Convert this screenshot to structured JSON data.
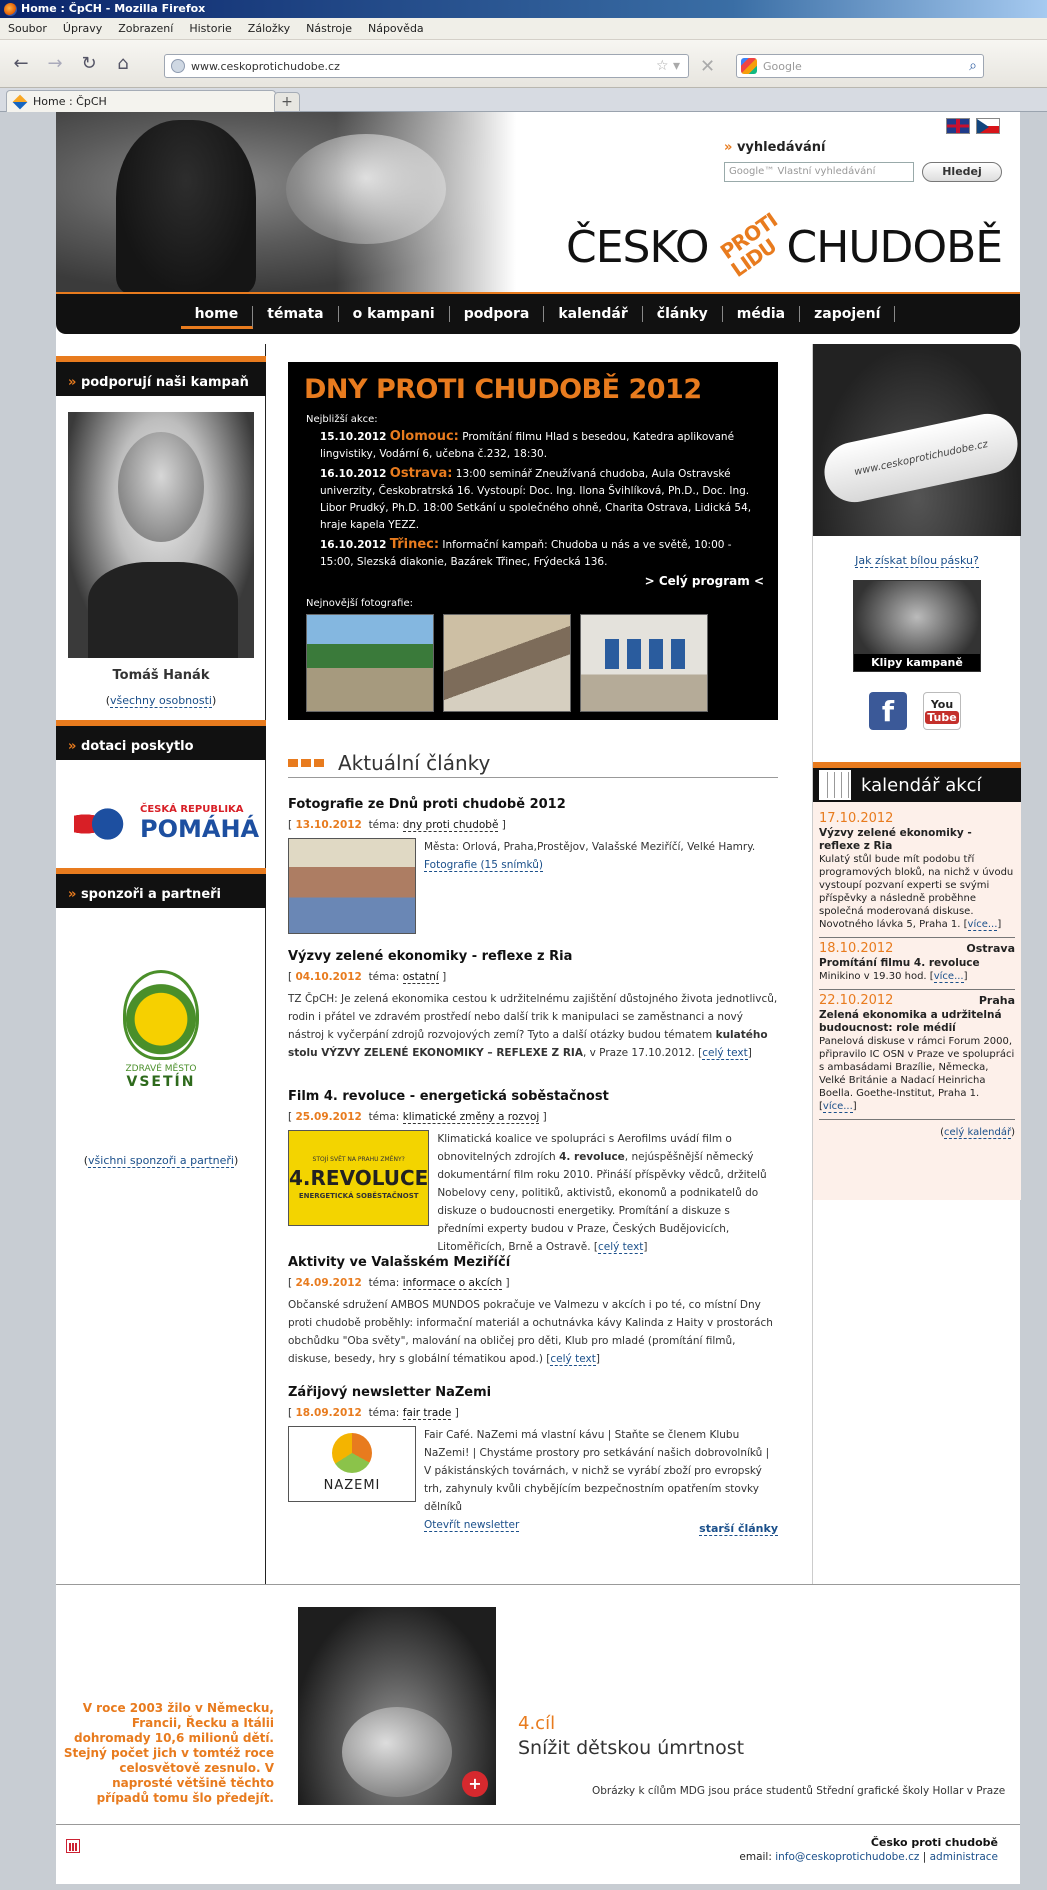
{
  "browser": {
    "title": "Home : ČpCH - Mozilla Firefox",
    "menu": [
      "Soubor",
      "Úpravy",
      "Zobrazení",
      "Historie",
      "Záložky",
      "Nástroje",
      "Nápověda"
    ],
    "url": "www.ceskoprotichudobe.cz",
    "search_placeholder": "Google",
    "tab_title": "Home : ČpCH",
    "new_tab": "+"
  },
  "header": {
    "search_label": "vyhledávání",
    "search_placeholder": "Google™ Vlastní vyhledávání",
    "search_button": "Hledej",
    "logo_left": "ČESKO",
    "logo_mid_top": "PROTI",
    "logo_mid_bottom": "LIDU",
    "logo_right": "CHUDOBĚ",
    "arrow": "»"
  },
  "nav": [
    "home",
    "témata",
    "o kampani",
    "podpora",
    "kalendář",
    "články",
    "média",
    "zapojení"
  ],
  "left": {
    "support_title": "podporují naši kampaň",
    "person_name": "Tomáš Hanák",
    "all_people_pre": "(",
    "all_people": "všechny osobnosti",
    "all_people_post": ")",
    "grant_title": "dotaci poskytlo",
    "cr_line1": "ČESKÁ REPUBLIKA",
    "cr_line2": "POMÁHÁ",
    "sponsors_title": "sponzoři a partneři",
    "vsetin_line1": "ZDRAVÉ MĚSTO",
    "vsetin_line2": "VSETÍN",
    "all_sponsors": "všichni sponzoři a partneři"
  },
  "banner": {
    "title": "DNY PROTI CHUDOBĚ 2012",
    "next_label": "Nejbližší akce:",
    "events": [
      {
        "date": "15.10.2012",
        "city": "Olomouc:",
        "text": "Promítání filmu Hlad s besedou, Katedra aplikované lingvistiky, Vodární 6, učebna č.232, 18:30."
      },
      {
        "date": "16.10.2012",
        "city": "Ostrava:",
        "text": "13:00 seminář Zneužívaná chudoba, Aula Ostravské univerzity, Českobratrská 16. Vystoupí: Doc. Ing. Ilona Švihlíková, Ph.D., Doc. Ing. Libor Prudký, Ph.D. 18:00 Setkání u společného ohně, Charita Ostrava, Lidická 54, hraje kapela YEZZ."
      },
      {
        "date": "16.10.2012",
        "city": "Třinec:",
        "text": "Informační kampaň: Chudoba u nás a ve světě, 10:00 - 15:00, Slezská diakonie, Bazárek Třinec, Frýdecká 136."
      }
    ],
    "full_program": "> Celý program <",
    "photos_label": "Nejnovější fotografie:"
  },
  "articles_title": "Aktuální články",
  "articles": [
    {
      "title": "Fotografie ze Dnů proti chudobě 2012",
      "date": "13.10.2012",
      "topic": "dny proti chudobě",
      "text": "Města: Orlová, Praha,Prostějov, Valašské Meziříčí, Velké Hamry.",
      "link": "Fotografie (15 snímků)"
    },
    {
      "title": "Výzvy zelené ekonomiky - reflexe z Ria",
      "date": "04.10.2012",
      "topic": "ostatní",
      "text": "TZ ČpCH: Je zelená ekonomika cestou k udržitelnému zajištění důstojného života jednotlivců, rodin i přátel ve zdravém prostředí nebo další trik k manipulaci se zaměstnanci a nový nástroj k vyčerpání zdrojů rozvojových zemí? Tyto a další otázky budou tématem",
      "bold": "kulatého stolu VÝZVY ZELENÉ EKONOMIKY – REFLEXE Z RIA",
      "text2": ", v Praze 17.10.2012.",
      "link": "celý text"
    },
    {
      "title": "Film 4. revoluce - energetická soběstačnost",
      "date": "25.09.2012",
      "topic": "klimatické změny a rozvoj",
      "text_a": "Klimatická koalice ve spolupráci s Aerofilms uvádí film o obnovitelných zdrojích",
      "bold": "4. revoluce",
      "text_b": ", nejúspěšnější německý dokumentární film roku 2010. Přináší příspěvky vědců, držitelů Nobelovy ceny, politiků, aktivistů, ekonomů a podnikatelů do diskuze o budoucnosti energetiky. Promítání a diskuze s předními experty budou v Praze, Českých Budějovicích, Litoměřicích, Brně a Ostravě.",
      "link": "celý text",
      "img_l1": "STOJÍ SVĚT NA PRAHU ZMĚNY?",
      "img_l2": "4.REVOLUCE",
      "img_l3": "ENERGETICKÁ SOBĚSTAČNOST"
    },
    {
      "title": "Aktivity ve Valašském Meziříčí",
      "date": "24.09.2012",
      "topic": "informace o akcích",
      "text": "Občanské sdružení AMBOS MUNDOS pokračuje ve Valmezu v akcích i po té, co místní Dny proti chudobě proběhly: informační materiál a ochutnávka kávy Kalinda z Haity v prostorách obchůdku \"Oba světy\", malování na obličej pro děti, Klub pro mladé (promítání filmů, diskuse, besedy, hry s globální tématikou apod.)",
      "link": "celý text"
    },
    {
      "title": "Zářijový newsletter NaZemi",
      "date": "18.09.2012",
      "topic": "fair trade",
      "text": "Fair Café. NaZemi má vlastní kávu | Staňte se členem Klubu NaZemi! | Chystáme prostory pro setkávání našich dobrovolníků | V pákistánských továrnách, v nichž se vyrábí zboží pro evropský trh, zahynuly kvůli chybějícím bezpečnostním opatřením stovky dělníků",
      "link": "Otevřít newsletter",
      "img_label": "NAZEMI"
    }
  ],
  "meta_topic_label": "téma:",
  "older_articles": "starší články",
  "right": {
    "bracelet_text": "www.ceskoprotichudobe.cz",
    "how_link": "Jak získat bílou pásku?",
    "video_caption": "Klipy kampaně",
    "fb": "f",
    "yt_top": "You",
    "yt_bottom": "Tube",
    "calendar_title": "kalendář akcí",
    "events": [
      {
        "date": "17.10.2012",
        "city": "",
        "title": "Výzvy zelené ekonomiky - reflexe z Ria",
        "text": "Kulatý stůl bude mít podobu tří programových bloků, na nichž v úvodu vystoupí pozvaní experti se svými příspěvky a následně proběhne společná moderovaná diskuse. Novotného lávka 5, Praha 1.",
        "link": "více..."
      },
      {
        "date": "18.10.2012",
        "city": "Ostrava",
        "title": "Promítání filmu 4. revoluce",
        "text": "Minikino v 19.30 hod.",
        "link": "více..."
      },
      {
        "date": "22.10.2012",
        "city": "Praha",
        "title": "Zelená ekonomika a udržitelná budoucnost: role médií",
        "text": "Panelová diskuse v rámci Forum 2000, připravilo IC OSN v Praze ve spolupráci s ambasádami Brazílie, Německa, Velké Británie a Nadací Heinricha Boella. Goethe-Institut, Praha 1.",
        "link": "více..."
      }
    ],
    "calendar_all": "celý kalendář"
  },
  "footer": {
    "fact": "V roce 2003 žilo v Německu, Francii, Řecku a Itálii dohromady 10,6 milionů dětí. Stejný počet jich v tomtéž roce celosvětově zesnulo. V naprosté většině těchto případů tomu šlo předejít.",
    "goal_no": "4.cíl",
    "goal": "Snížit dětskou úmrtnost",
    "mdg_note": "Obrázky k cílům MDG jsou práce studentů Střední grafické školy Hollar v Praze",
    "org": "Česko proti chudobě",
    "email_label": "email:",
    "email": "info@ceskoprotichudobe.cz",
    "sep": "|",
    "admin": "administrace"
  },
  "colors": {
    "accent": "#e87b1e",
    "link": "#1a4f8a",
    "dark": "#111111"
  }
}
